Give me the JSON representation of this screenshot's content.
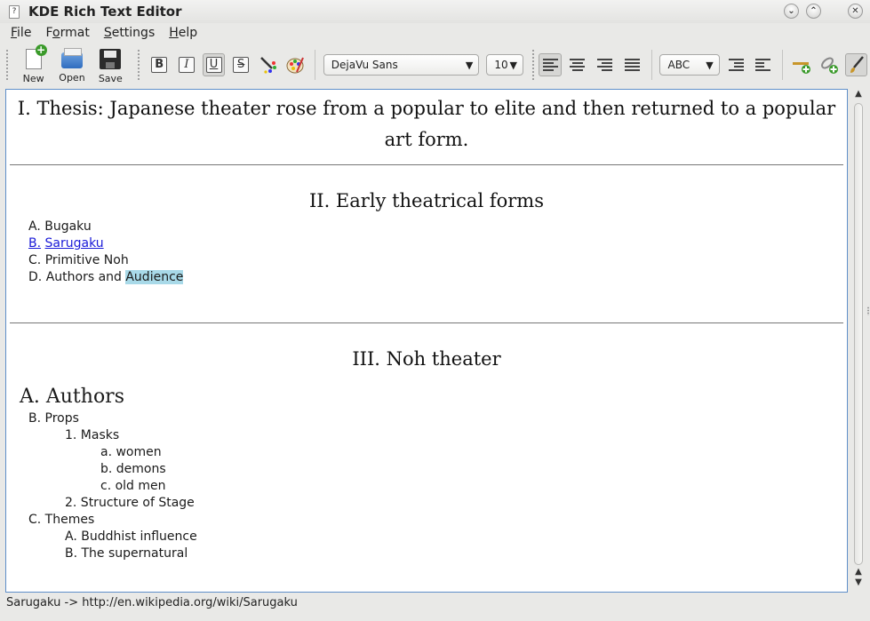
{
  "window": {
    "title": "KDE Rich Text Editor",
    "app_icon": "?"
  },
  "menu": [
    {
      "prefix": "",
      "accel": "F",
      "rest": "ile"
    },
    {
      "prefix": "F",
      "accel": "o",
      "rest": "rmat"
    },
    {
      "prefix": "",
      "accel": "S",
      "rest": "ettings"
    },
    {
      "prefix": "",
      "accel": "H",
      "rest": "elp"
    }
  ],
  "toolbar": {
    "new_label": "New",
    "open_label": "Open",
    "save_label": "Save",
    "bold": "B",
    "italic": "I",
    "underline": "U",
    "strike": "S",
    "font_family": "DejaVu Sans",
    "font_size": "10",
    "spell_mode": "ABC"
  },
  "document": {
    "thesis": "I. Thesis: Japanese theater rose from a popular to elite and then returned to a popular art form.",
    "section2_title": "II. Early theatrical forms",
    "section2_items": [
      {
        "marker": "A.",
        "text": "Bugaku"
      },
      {
        "marker": "B.",
        "text": "Sarugaku"
      },
      {
        "marker": "C.",
        "text": "Primitive Noh"
      },
      {
        "marker": "D.",
        "text": "Authors and ",
        "highlight": "Audience"
      }
    ],
    "section3_title": "III. Noh theater",
    "section3_subheading": "A. Authors",
    "section3_items": [
      {
        "indent": 0,
        "text": "B. Props"
      },
      {
        "indent": 1,
        "text": "1. Masks"
      },
      {
        "indent": 2,
        "text": "a. women"
      },
      {
        "indent": 2,
        "text": "b. demons"
      },
      {
        "indent": 2,
        "text": "c. old men"
      },
      {
        "indent": 1,
        "text": "2. Structure of Stage"
      },
      {
        "indent": 0,
        "text": "C. Themes"
      },
      {
        "indent": 1,
        "text": "A. Buddhist influence"
      },
      {
        "indent": 1,
        "text": "B. The supernatural"
      }
    ]
  },
  "status": "Sarugaku -> http://en.wikipedia.org/wiki/Sarugaku",
  "colors": {
    "link": "#1a1ad8",
    "highlight": "#a8d9e8",
    "editor_border": "#5f8fc9"
  }
}
